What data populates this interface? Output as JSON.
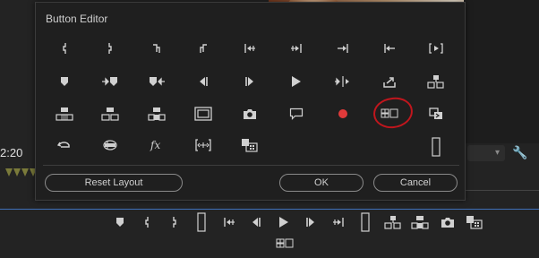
{
  "dialog": {
    "title": "Button Editor",
    "reset_label": "Reset Layout",
    "ok_label": "OK",
    "cancel_label": "Cancel"
  },
  "background": {
    "timecode": "2:20"
  },
  "colors": {
    "accent_red": "#e03a3a",
    "annotation": "#c0161d",
    "playhead_blue": "#3f6fb8"
  },
  "grid_icons": [
    [
      "mark-in-icon",
      "mark-out-icon",
      "mark-clip-in-icon",
      "mark-clip-out-icon",
      "go-to-in-icon",
      "go-to-out-icon",
      "go-to-next-edit-icon",
      "go-to-previous-edit-icon",
      "play-in-to-out-icon"
    ],
    [
      "add-marker-icon",
      "go-to-next-marker-icon",
      "go-to-previous-marker-icon",
      "step-back-icon",
      "step-forward-icon",
      "play-icon",
      "play-around-icon",
      "export-frame-icon",
      "insert-icon"
    ],
    [
      "lift-icon",
      "extract-icon",
      "overwrite-icon",
      "safe-margins-icon",
      "camera-icon",
      "comment-icon",
      "record-icon",
      "multi-camera-icon",
      "toggle-proxies-icon"
    ],
    [
      "loop-icon",
      "vr-video-icon",
      "fx-icon",
      "trim-monitor-icon",
      "compare-view-icon",
      "",
      "",
      "",
      "spacer-icon"
    ]
  ],
  "transport_icons": [
    "add-marker-icon",
    "mark-in-icon",
    "mark-out-icon",
    "spacer-icon",
    "go-to-in-icon",
    "step-back-icon",
    "play-icon",
    "step-forward-icon",
    "go-to-out-icon",
    "spacer-icon",
    "insert-icon",
    "overwrite-icon",
    "camera-icon",
    "compare-view-icon"
  ],
  "transport_row2_icon": "multi-camera-icon"
}
